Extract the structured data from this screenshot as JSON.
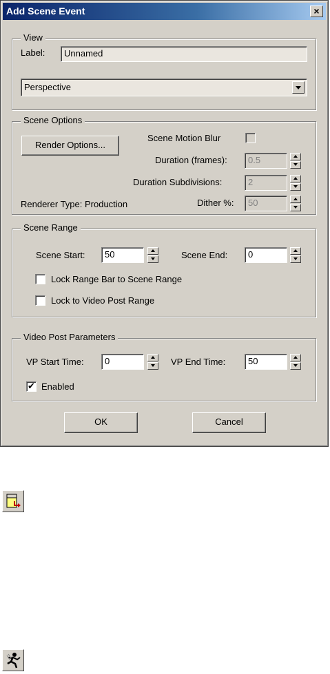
{
  "dialog": {
    "title": "Add Scene Event",
    "close_glyph": "×"
  },
  "view": {
    "group_title": "View",
    "label_caption": "Label:",
    "label_value": "Unnamed",
    "viewport_value": "Perspective"
  },
  "scene_options": {
    "group_title": "Scene Options",
    "render_options_button": "Render Options...",
    "motion_blur_label": "Scene Motion Blur",
    "motion_blur_checked": false,
    "duration_label": "Duration (frames):",
    "duration_value": "0.5",
    "subdivisions_label": "Duration Subdivisions:",
    "subdivisions_value": "2",
    "renderer_type_label": "Renderer Type:  Production",
    "dither_label": "Dither %:",
    "dither_value": "50"
  },
  "scene_range": {
    "group_title": "Scene Range",
    "start_label": "Scene Start:",
    "start_value": "50",
    "end_label": "Scene End:",
    "end_value": "0",
    "lock_range_bar_label": "Lock Range Bar to Scene Range",
    "lock_range_bar_checked": false,
    "lock_video_post_label": "Lock to Video Post Range",
    "lock_video_post_checked": false
  },
  "video_post": {
    "group_title": "Video Post Parameters",
    "vp_start_label": "VP Start Time:",
    "vp_start_value": "0",
    "vp_end_label": "VP End Time:",
    "vp_end_value": "50",
    "enabled_label": "Enabled",
    "enabled_checked": true,
    "check_glyph": "✔"
  },
  "buttons": {
    "ok": "OK",
    "cancel": "Cancel"
  },
  "icons": {
    "add_scene_event_icon": "add-scene-event-icon",
    "running-figure_icon": "running-figure-icon"
  }
}
